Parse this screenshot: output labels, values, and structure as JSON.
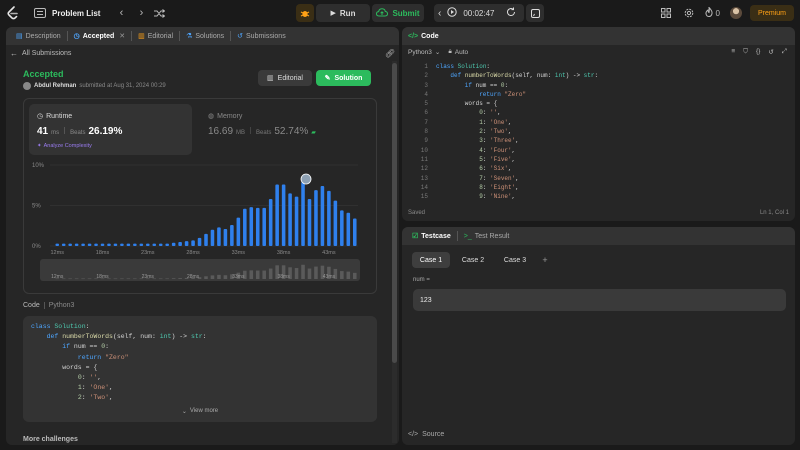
{
  "topbar": {
    "title": "Problem List",
    "run_label": "Run",
    "submit_label": "Submit",
    "timer": "00:02:47",
    "streak": "0",
    "premium_label": "Premium"
  },
  "left": {
    "tabs": [
      {
        "label": "Description"
      },
      {
        "label": "Accepted"
      },
      {
        "label": "Editorial"
      },
      {
        "label": "Solutions"
      },
      {
        "label": "Submissions"
      }
    ],
    "back_label": "All Submissions",
    "status": "Accepted",
    "user": "Abdul Rehman",
    "submitted_text": "submitted at Aug 31, 2024 00:29",
    "editorial_btn": "Editorial",
    "solution_btn": "Solution",
    "runtime": {
      "title": "Runtime",
      "value": "41",
      "unit": "ms",
      "beats_label": "Beats",
      "beats": "26.19%",
      "analyze": "Analyze Complexity"
    },
    "memory": {
      "title": "Memory",
      "value": "16.69",
      "unit": "MB",
      "beats_label": "Beats",
      "beats": "52.74%"
    },
    "code_label": "Code",
    "code_lang": "Python3",
    "code_lines": [
      [
        {
          "t": "class ",
          "c": "kw"
        },
        {
          "t": "Solution",
          "c": "ty"
        },
        {
          "t": ":",
          "c": "txt"
        }
      ],
      [
        {
          "t": "    def ",
          "c": "kw"
        },
        {
          "t": "numberToWords",
          "c": "fn"
        },
        {
          "t": "(self, num: ",
          "c": "txt"
        },
        {
          "t": "int",
          "c": "ty"
        },
        {
          "t": ") -> ",
          "c": "txt"
        },
        {
          "t": "str",
          "c": "ty"
        },
        {
          "t": ":",
          "c": "txt"
        }
      ],
      [
        {
          "t": "        if ",
          "c": "kw"
        },
        {
          "t": "num == ",
          "c": "txt"
        },
        {
          "t": "0",
          "c": "num"
        },
        {
          "t": ":",
          "c": "txt"
        }
      ],
      [
        {
          "t": "            return ",
          "c": "kw"
        },
        {
          "t": "\"Zero\"",
          "c": "str"
        }
      ],
      [
        {
          "t": "        words = {",
          "c": "txt"
        }
      ],
      [
        {
          "t": "            ",
          "c": "txt"
        },
        {
          "t": "0",
          "c": "num"
        },
        {
          "t": ": ",
          "c": "txt"
        },
        {
          "t": "''",
          "c": "str"
        },
        {
          "t": ",",
          "c": "txt"
        }
      ],
      [
        {
          "t": "            ",
          "c": "txt"
        },
        {
          "t": "1",
          "c": "num"
        },
        {
          "t": ": ",
          "c": "txt"
        },
        {
          "t": "'One'",
          "c": "str"
        },
        {
          "t": ",",
          "c": "txt"
        }
      ],
      [
        {
          "t": "            ",
          "c": "txt"
        },
        {
          "t": "2",
          "c": "num"
        },
        {
          "t": ": ",
          "c": "txt"
        },
        {
          "t": "'Two'",
          "c": "str"
        },
        {
          "t": ",",
          "c": "txt"
        }
      ]
    ],
    "view_more": "View more",
    "more_challenges": "More challenges"
  },
  "chart_data": {
    "type": "bar",
    "categories": [
      "12ms",
      "",
      "",
      "",
      "",
      "",
      "",
      "18ms",
      "",
      "",
      "",
      "",
      "",
      "",
      "23ms",
      "",
      "",
      "",
      "",
      "",
      "",
      "28ms",
      "",
      "",
      "",
      "",
      "",
      "",
      "33ms",
      "",
      "",
      "",
      "",
      "",
      "",
      "38ms",
      "",
      "",
      "",
      "",
      "",
      "",
      "43ms"
    ],
    "values": [
      0.3,
      0.3,
      0.3,
      0.3,
      0.3,
      0.3,
      0.3,
      0.3,
      0.3,
      0.3,
      0.3,
      0.3,
      0.3,
      0.3,
      0.3,
      0.3,
      0.3,
      0.3,
      0.4,
      0.5,
      0.6,
      0.7,
      1.0,
      1.5,
      2.0,
      2.3,
      2.1,
      2.6,
      3.5,
      4.6,
      4.8,
      4.7,
      4.7,
      5.8,
      7.6,
      7.6,
      6.5,
      6.1,
      7.9,
      5.8,
      6.9,
      7.4,
      6.8,
      5.6,
      4.4,
      4.1,
      3.4
    ],
    "ytick_labels": [
      "10%",
      "5%",
      "0%"
    ],
    "ylim": [
      0,
      10
    ],
    "xtick_labels": [
      "12ms",
      "18ms",
      "23ms",
      "28ms",
      "33ms",
      "38ms",
      "43ms"
    ],
    "highlight_index": 38
  },
  "right": {
    "code_title": "Code",
    "lang": "Python3",
    "mode": "Auto",
    "lines": [
      [
        {
          "t": "class ",
          "c": "kw"
        },
        {
          "t": "Solution",
          "c": "ty"
        },
        {
          "t": ":",
          "c": "txt"
        }
      ],
      [
        {
          "t": "    def ",
          "c": "kw"
        },
        {
          "t": "numberToWords",
          "c": "fn"
        },
        {
          "t": "(self, num: ",
          "c": "txt"
        },
        {
          "t": "int",
          "c": "ty"
        },
        {
          "t": ") -> ",
          "c": "txt"
        },
        {
          "t": "str",
          "c": "ty"
        },
        {
          "t": ":",
          "c": "txt"
        }
      ],
      [
        {
          "t": "        if ",
          "c": "kw"
        },
        {
          "t": "num == ",
          "c": "txt"
        },
        {
          "t": "0",
          "c": "num"
        },
        {
          "t": ":",
          "c": "txt"
        }
      ],
      [
        {
          "t": "            return ",
          "c": "kw"
        },
        {
          "t": "\"Zero\"",
          "c": "str"
        }
      ],
      [
        {
          "t": "        words = {",
          "c": "txt"
        }
      ],
      [
        {
          "t": "            ",
          "c": "txt"
        },
        {
          "t": "0",
          "c": "num"
        },
        {
          "t": ": ",
          "c": "txt"
        },
        {
          "t": "''",
          "c": "str"
        },
        {
          "t": ",",
          "c": "txt"
        }
      ],
      [
        {
          "t": "            ",
          "c": "txt"
        },
        {
          "t": "1",
          "c": "num"
        },
        {
          "t": ": ",
          "c": "txt"
        },
        {
          "t": "'One'",
          "c": "str"
        },
        {
          "t": ",",
          "c": "txt"
        }
      ],
      [
        {
          "t": "            ",
          "c": "txt"
        },
        {
          "t": "2",
          "c": "num"
        },
        {
          "t": ": ",
          "c": "txt"
        },
        {
          "t": "'Two'",
          "c": "str"
        },
        {
          "t": ",",
          "c": "txt"
        }
      ],
      [
        {
          "t": "            ",
          "c": "txt"
        },
        {
          "t": "3",
          "c": "num"
        },
        {
          "t": ": ",
          "c": "txt"
        },
        {
          "t": "'Three'",
          "c": "str"
        },
        {
          "t": ",",
          "c": "txt"
        }
      ],
      [
        {
          "t": "            ",
          "c": "txt"
        },
        {
          "t": "4",
          "c": "num"
        },
        {
          "t": ": ",
          "c": "txt"
        },
        {
          "t": "'Four'",
          "c": "str"
        },
        {
          "t": ",",
          "c": "txt"
        }
      ],
      [
        {
          "t": "            ",
          "c": "txt"
        },
        {
          "t": "5",
          "c": "num"
        },
        {
          "t": ": ",
          "c": "txt"
        },
        {
          "t": "'Five'",
          "c": "str"
        },
        {
          "t": ",",
          "c": "txt"
        }
      ],
      [
        {
          "t": "            ",
          "c": "txt"
        },
        {
          "t": "6",
          "c": "num"
        },
        {
          "t": ": ",
          "c": "txt"
        },
        {
          "t": "'Six'",
          "c": "str"
        },
        {
          "t": ",",
          "c": "txt"
        }
      ],
      [
        {
          "t": "            ",
          "c": "txt"
        },
        {
          "t": "7",
          "c": "num"
        },
        {
          "t": ": ",
          "c": "txt"
        },
        {
          "t": "'Seven'",
          "c": "str"
        },
        {
          "t": ",",
          "c": "txt"
        }
      ],
      [
        {
          "t": "            ",
          "c": "txt"
        },
        {
          "t": "8",
          "c": "num"
        },
        {
          "t": ": ",
          "c": "txt"
        },
        {
          "t": "'Eight'",
          "c": "str"
        },
        {
          "t": ",",
          "c": "txt"
        }
      ],
      [
        {
          "t": "            ",
          "c": "txt"
        },
        {
          "t": "9",
          "c": "num"
        },
        {
          "t": ": ",
          "c": "txt"
        },
        {
          "t": "'Nine'",
          "c": "str"
        },
        {
          "t": ",",
          "c": "txt"
        }
      ]
    ],
    "saved": "Saved",
    "cursor": "Ln 1, Col 1",
    "testcase_tab": "Testcase",
    "result_tab": "Test Result",
    "cases": [
      "Case 1",
      "Case 2",
      "Case 3"
    ],
    "var_label": "num =",
    "var_value": "123",
    "source_label": "Source"
  },
  "colors": {
    "accent": "#2cbb5d",
    "bar": "#2f80ed",
    "orange": "#ffa116"
  }
}
